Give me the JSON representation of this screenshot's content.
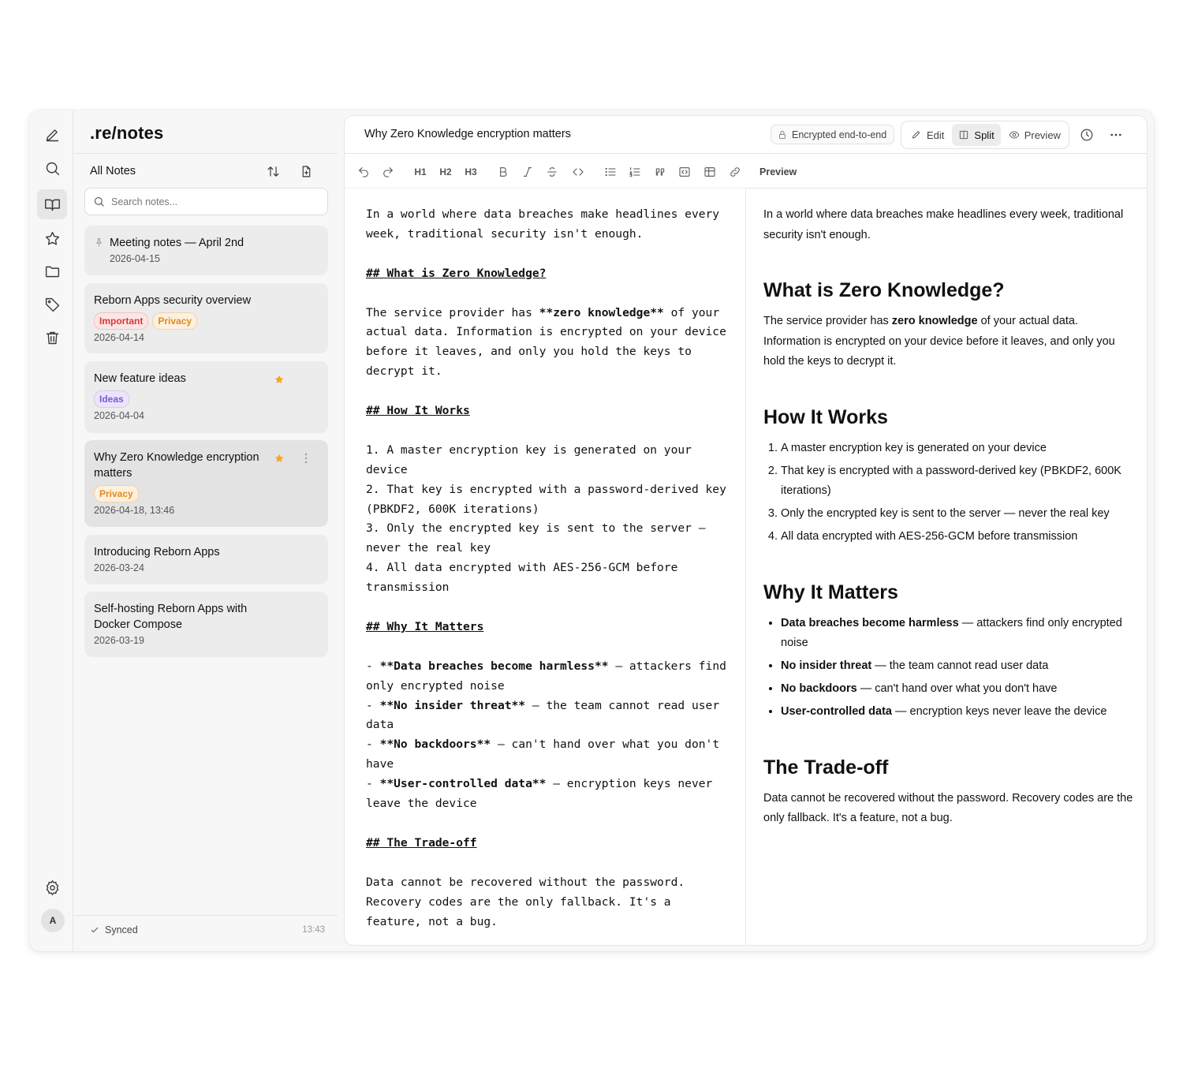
{
  "brand": ".re/notes",
  "list": {
    "title": "All Notes",
    "search_placeholder": "Search notes...",
    "notes": [
      {
        "title": "Meeting notes — April 2nd",
        "date": "2026-04-15",
        "pinned": true
      },
      {
        "title": "Reborn Apps security overview",
        "tags": [
          "Important",
          "Privacy"
        ],
        "date": "2026-04-14"
      },
      {
        "title": "New feature ideas",
        "tags": [
          "Ideas"
        ],
        "date": "2026-04-04",
        "starred": true
      },
      {
        "title": "Why Zero Knowledge encryption matters",
        "tags": [
          "Privacy"
        ],
        "date": "2026-04-18, 13:46",
        "starred": true,
        "selected": true
      },
      {
        "title": "Introducing Reborn Apps",
        "date": "2026-03-24"
      },
      {
        "title": "Self-hosting Reborn Apps with Docker Compose",
        "date": "2026-03-19"
      }
    ],
    "status": "Synced",
    "status_time": "13:43"
  },
  "rail": {
    "icons": [
      "pencil-icon",
      "search-icon",
      "book-icon",
      "star-icon",
      "folder-icon",
      "tag-icon",
      "trash-icon",
      "gear-icon"
    ],
    "avatar": "A"
  },
  "editor": {
    "title": "Why Zero Knowledge encryption matters",
    "badge": "Encrypted end-to-end",
    "modes": [
      "Edit",
      "Split",
      "Preview"
    ],
    "active_mode": "Split",
    "toolbar": [
      "undo",
      "redo",
      "H1",
      "H2",
      "H3",
      "bold",
      "italic",
      "strikethrough",
      "code",
      "bullet-list",
      "numbered-list",
      "quote",
      "code-block",
      "table",
      "link"
    ],
    "preview_label": "Preview",
    "source": {
      "intro": "In a world where data breaches make headlines every week, traditional security isn't enough.",
      "h_what": "## What is Zero Knowledge?",
      "zk_pre": "The service provider has ",
      "zk_bold": "**zero knowledge**",
      "zk_post": " of your actual data. Information is encrypted on your device before it leaves, and only you hold the keys to decrypt it.",
      "h_how": "## How It Works",
      "step1": "1. A master encryption key is generated on your device",
      "step2": "2. That key is encrypted with a password-derived key (PBKDF2, 600K iterations)",
      "step3": "3. Only the encrypted key is sent to the server — never the real key",
      "step4": "4. All data encrypted with AES-256-GCM before transmission",
      "h_why": "## Why It Matters",
      "b1_bold": "**Data breaches become harmless**",
      "b1_rest": " — attackers find only encrypted noise",
      "b2_bold": "**No insider threat**",
      "b2_rest": " — the team cannot read user data",
      "b3_bold": "**No backdoors**",
      "b3_rest": " — can't hand over what you don't have",
      "b4_bold": "**User-controlled data**",
      "b4_rest": " — encryption keys never leave the device",
      "h_trade": "## The Trade-off",
      "outro": "Data cannot be recovered without the password. Recovery codes are the only fallback. It's a feature, not a bug."
    },
    "preview": {
      "intro": "In a world where data breaches make headlines every week, traditional security isn't enough.",
      "h_what": "What is Zero Knowledge?",
      "zk_pre": "The service provider has ",
      "zk_bold": "zero knowledge",
      "zk_post": " of your actual data. Information is encrypted on your device before it leaves, and only you hold the keys to decrypt it.",
      "h_how": "How It Works",
      "steps": [
        "A master encryption key is generated on your device",
        "That key is encrypted with a password-derived key (PBKDF2, 600K iterations)",
        "Only the encrypted key is sent to the server — never the real key",
        "All data encrypted with AES-256-GCM before transmission"
      ],
      "h_why": "Why It Matters",
      "bullets": [
        {
          "bold": "Data breaches become harmless",
          "rest": " — attackers find only encrypted noise"
        },
        {
          "bold": "No insider threat",
          "rest": " — the team cannot read user data"
        },
        {
          "bold": "No backdoors",
          "rest": " — can't hand over what you don't have"
        },
        {
          "bold": "User-controlled data",
          "rest": " — encryption keys never leave the device"
        }
      ],
      "h_trade": "The Trade-off",
      "outro": "Data cannot be recovered without the password. Recovery codes are the only fallback. It's a feature, not a bug."
    }
  },
  "colors": {
    "star": "#f5a623",
    "tag_red": "#d33a3a",
    "tag_orange": "#e08a1e",
    "tag_purple": "#7a58d6"
  }
}
